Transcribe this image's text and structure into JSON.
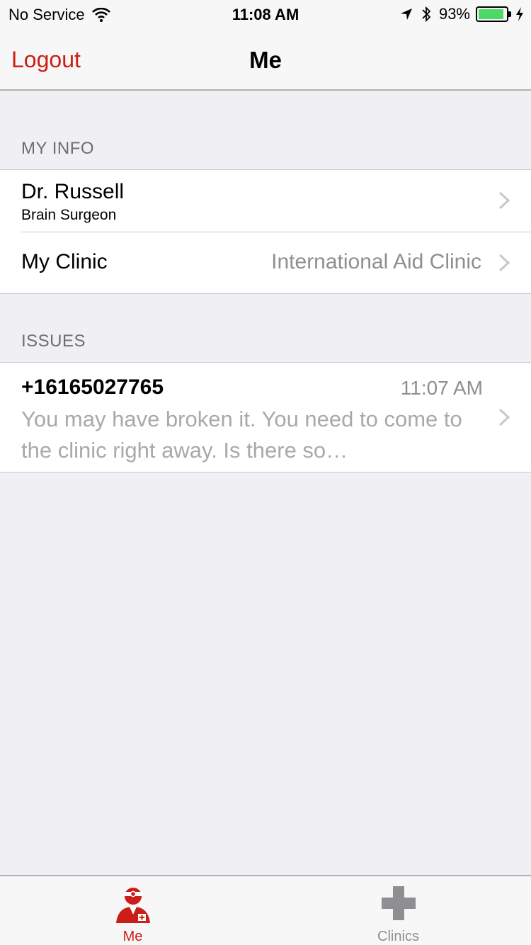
{
  "status_bar": {
    "carrier": "No Service",
    "time": "11:08 AM",
    "battery": "93%",
    "battery_level": 0.93,
    "icons": [
      "wifi-icon",
      "location-arrow-icon",
      "bluetooth-icon",
      "battery-icon",
      "charging-bolt-icon"
    ]
  },
  "nav": {
    "left_button": "Logout",
    "title": "Me"
  },
  "my_info": {
    "header": "MY INFO",
    "name": "Dr. Russell",
    "role": "Brain Surgeon",
    "clinic_label": "My Clinic",
    "clinic_value": "International Aid Clinic"
  },
  "issues": {
    "header": "ISSUES",
    "items": [
      {
        "phone": "+16165027765",
        "time": "11:07 AM",
        "preview": "You may have broken it. You need to come to the clinic right away. Is there so…"
      }
    ]
  },
  "tabbar": {
    "tabs": [
      {
        "label": "Me",
        "icon": "doctor-icon",
        "selected": true
      },
      {
        "label": "Clinics",
        "icon": "cross-icon",
        "selected": false
      }
    ]
  },
  "colors": {
    "accent": "#cc1d16",
    "inactive_tab": "#8e8e93",
    "background": "#efeff4",
    "battery": "#4cd964"
  }
}
